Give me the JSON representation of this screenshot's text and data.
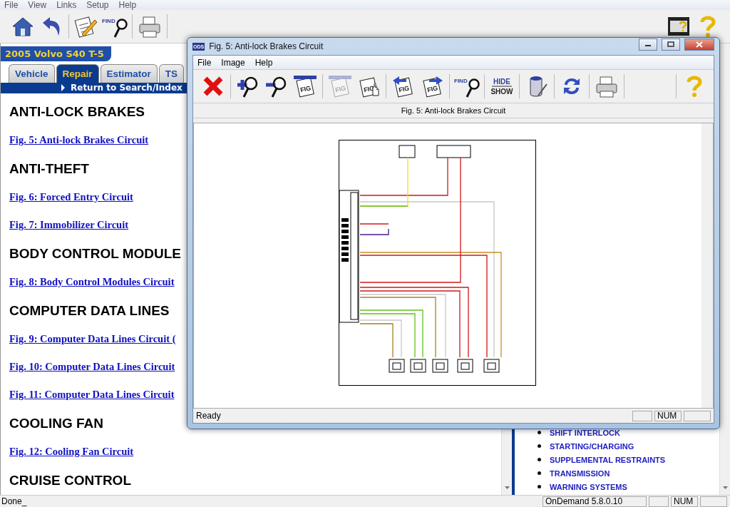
{
  "menu_bar": [
    "File",
    "View",
    "Links",
    "Setup",
    "Help"
  ],
  "toolbar": {
    "left": [
      [
        {
          "kind": "home"
        },
        {
          "kind": "back"
        }
      ],
      [
        {
          "kind": "notes"
        },
        {
          "kind": "find",
          "label": "FIND"
        }
      ],
      [
        {
          "kind": "print"
        }
      ]
    ],
    "right": [
      [
        {
          "kind": "video-help"
        },
        {
          "kind": "help"
        }
      ]
    ]
  },
  "vehicle": "2005 Volvo S40 T-5",
  "tabs": [
    {
      "label": "Vehicle",
      "selected": false
    },
    {
      "label": "Repair",
      "selected": true
    },
    {
      "label": "Estimator",
      "selected": false
    },
    {
      "label": "TS",
      "selected": false
    }
  ],
  "return_link": "Return to Search/Index",
  "sections": [
    {
      "heading": "ANTI-LOCK BRAKES",
      "links": [
        "Fig. 5: Anti-lock Brakes Circuit"
      ]
    },
    {
      "heading": "ANTI-THEFT",
      "links": [
        "Fig. 6: Forced Entry Circuit",
        "Fig. 7: Immobilizer Circuit"
      ]
    },
    {
      "heading": "BODY CONTROL MODULE",
      "links": [
        "Fig. 8: Body Control Modules Circuit"
      ]
    },
    {
      "heading": "COMPUTER DATA LINES",
      "links": [
        "Fig. 9: Computer Data Lines Circuit (",
        "Fig. 10: Computer Data Lines Circuit",
        "Fig. 11: Computer Data Lines Circuit"
      ]
    },
    {
      "heading": "COOLING FAN",
      "links": [
        "Fig. 12: Cooling Fan Circuit"
      ]
    },
    {
      "heading": "CRUISE CONTROL"
    }
  ],
  "side_list": [
    "SHIFT INTERLOCK",
    "STARTING/CHARGING",
    "SUPPLEMENTAL RESTRAINTS",
    "TRANSMISSION",
    "WARNING SYSTEMS"
  ],
  "status_bar": {
    "message": "Done_",
    "version": "OnDemand 5.8.0.10",
    "num": "NUM"
  },
  "figure_window": {
    "app_badge": "ODS",
    "title": "Fig. 5: Anti-lock Brakes Circuit",
    "menu": [
      "File",
      "Image",
      "Help"
    ],
    "toolbar": [
      [
        {
          "kind": "close",
          "disabled": false
        }
      ],
      [
        {
          "kind": "zoom-in",
          "disabled": false
        },
        {
          "kind": "zoom-out",
          "disabled": false
        },
        {
          "kind": "fit",
          "label": "FIG",
          "disabled": false
        }
      ],
      [
        {
          "kind": "fig-window",
          "label": "FIG",
          "disabled": true
        },
        {
          "kind": "fig-hand",
          "label": "FIG",
          "disabled": false
        }
      ],
      [
        {
          "kind": "fig-prev",
          "label": "FIG",
          "disabled": false
        },
        {
          "kind": "fig-next",
          "label": "FIG",
          "disabled": false
        }
      ],
      [
        {
          "kind": "find",
          "label": "FIND",
          "disabled": false
        }
      ],
      [
        {
          "kind": "hide-show",
          "label": "HIDE",
          "label2": "SHOW",
          "disabled": false
        }
      ],
      [
        {
          "kind": "paint",
          "disabled": false
        }
      ],
      [
        {
          "kind": "refresh",
          "disabled": false
        }
      ],
      [
        {
          "kind": "print",
          "disabled": false
        }
      ],
      [
        {
          "kind": "help",
          "disabled": false
        }
      ]
    ],
    "caption": "Fig. 5: Anti-lock Brakes Circuit",
    "status": "Ready",
    "num": "NUM"
  }
}
